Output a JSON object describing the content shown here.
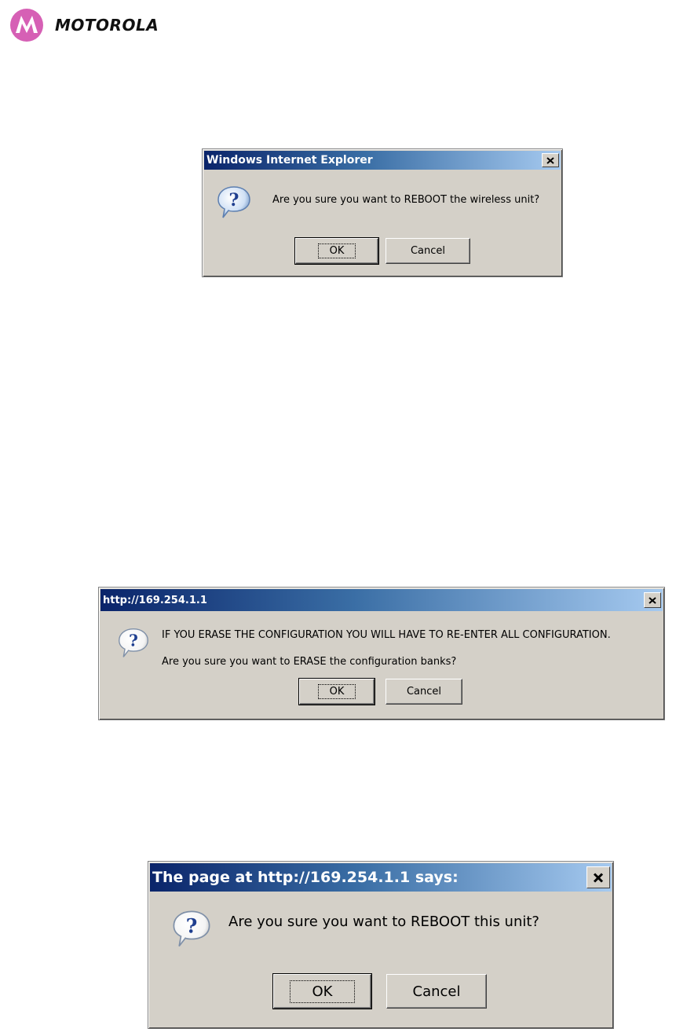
{
  "logo": {
    "text": "MOTOROLA",
    "mark_color": "#d660b5"
  },
  "dialogs": [
    {
      "title": "Windows Internet Explorer",
      "icon": "question-icon",
      "message": "Are you sure you want to REBOOT the wireless unit?",
      "ok_label": "OK",
      "cancel_label": "Cancel"
    },
    {
      "title": "http://169.254.1.1",
      "icon": "question-icon",
      "message_line1": "IF YOU ERASE THE CONFIGURATION YOU WILL HAVE TO RE-ENTER ALL CONFIGURATION.",
      "message_line2": "Are you sure you want to ERASE the configuration banks?",
      "ok_label": "OK",
      "cancel_label": "Cancel"
    },
    {
      "title": "The page at http://169.254.1.1 says:",
      "icon": "question-icon",
      "message": "Are you sure you want to REBOOT this unit?",
      "ok_label": "OK",
      "cancel_label": "Cancel"
    }
  ],
  "colors": {
    "dialog_face": "#d4d0c8",
    "title_start": "#0a246a",
    "title_end": "#a6caf0"
  }
}
